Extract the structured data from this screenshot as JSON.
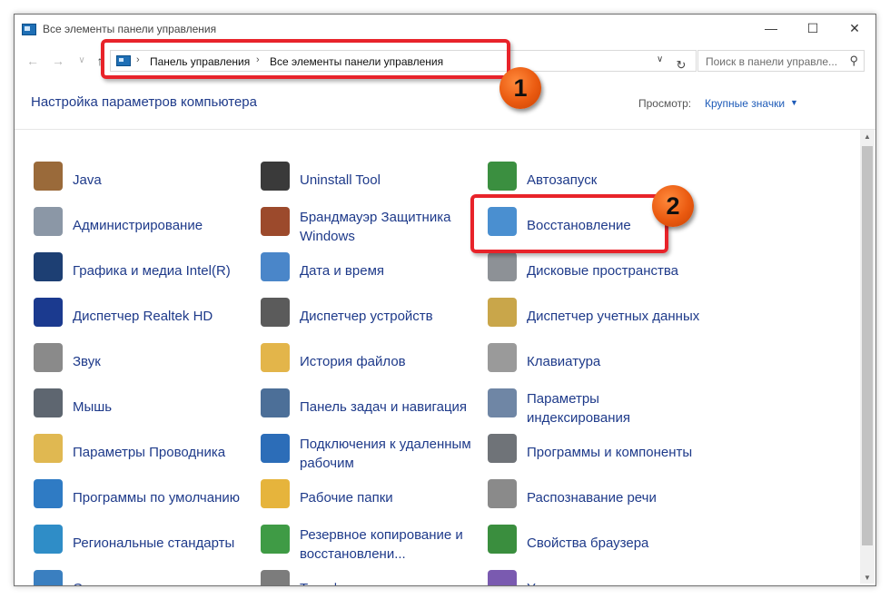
{
  "window": {
    "title": "Все элементы панели управления"
  },
  "breadcrumb": [
    "Панель управления",
    "Все элементы панели управления"
  ],
  "search": {
    "placeholder": "Поиск в панели управле..."
  },
  "heading": "Настройка параметров компьютера",
  "view": {
    "label": "Просмотр:",
    "value": "Крупные значки"
  },
  "badges": [
    "1",
    "2"
  ],
  "columns": [
    [
      {
        "label": "Java",
        "icon": "java-cup-icon",
        "color": "#9a6a3a"
      },
      {
        "label": "Администрирование",
        "icon": "admin-tools-icon",
        "color": "#8b97a6"
      },
      {
        "label": "Графика и медиа Intel(R)",
        "icon": "intel-graphics-icon",
        "color": "#1d3f73"
      },
      {
        "label": "Диспетчер Realtek HD",
        "icon": "realtek-audio-icon",
        "color": "#1b3a8f"
      },
      {
        "label": "Звук",
        "icon": "speaker-icon",
        "color": "#8a8a8a"
      },
      {
        "label": "Мышь",
        "icon": "mouse-icon",
        "color": "#5e6670"
      },
      {
        "label": "Параметры Проводника",
        "icon": "explorer-options-icon",
        "color": "#e0b851"
      },
      {
        "label": "Программы по умолчанию",
        "icon": "default-programs-icon",
        "color": "#2f7bc4"
      },
      {
        "label": "Региональные стандарты",
        "icon": "region-clock-icon",
        "color": "#2f8dc7"
      },
      {
        "label": "Система",
        "icon": "system-icon",
        "color": "#3a7fc0"
      }
    ],
    [
      {
        "label": "Uninstall Tool",
        "icon": "uninstall-tool-icon",
        "color": "#3a3a3a"
      },
      {
        "label": "Брандмауэр Защитника Windows",
        "icon": "firewall-icon",
        "color": "#9c4a2c"
      },
      {
        "label": "Дата и время",
        "icon": "calendar-clock-icon",
        "color": "#4a86c9"
      },
      {
        "label": "Диспетчер устройств",
        "icon": "device-manager-icon",
        "color": "#5b5b5b"
      },
      {
        "label": "История файлов",
        "icon": "file-history-icon",
        "color": "#e3b54a"
      },
      {
        "label": "Панель задач и навигация",
        "icon": "taskbar-icon",
        "color": "#4c6f98"
      },
      {
        "label": "Подключения к удаленным рабочим",
        "icon": "remote-desktop-icon",
        "color": "#2c6db8"
      },
      {
        "label": "Рабочие папки",
        "icon": "work-folders-icon",
        "color": "#e6b43c"
      },
      {
        "label": "Резервное копирование и восстановлени...",
        "icon": "backup-icon",
        "color": "#3f9b45"
      },
      {
        "label": "Телефон и модем",
        "icon": "phone-modem-icon",
        "color": "#7c7c7c"
      }
    ],
    [
      {
        "label": "Автозапуск",
        "icon": "autoplay-icon",
        "color": "#3b8f40"
      },
      {
        "label": "Восстановление",
        "icon": "recovery-icon",
        "color": "#4a8fd0"
      },
      {
        "label": "Дисковые пространства",
        "icon": "storage-spaces-icon",
        "color": "#8d9196"
      },
      {
        "label": "Диспетчер учетных данных",
        "icon": "credential-safe-icon",
        "color": "#c9a64a"
      },
      {
        "label": "Клавиатура",
        "icon": "keyboard-icon",
        "color": "#9a9a9a"
      },
      {
        "label": "Параметры индексирования",
        "icon": "indexing-icon",
        "color": "#6f86a5"
      },
      {
        "label": "Программы и компоненты",
        "icon": "programs-features-icon",
        "color": "#6f7378"
      },
      {
        "label": "Распознавание речи",
        "icon": "microphone-icon",
        "color": "#8a8a8a"
      },
      {
        "label": "Свойства браузера",
        "icon": "browser-globe-icon",
        "color": "#3a8e3e"
      },
      {
        "label": "Управление цветом",
        "icon": "color-management-icon",
        "color": "#7a5ab0"
      }
    ]
  ]
}
